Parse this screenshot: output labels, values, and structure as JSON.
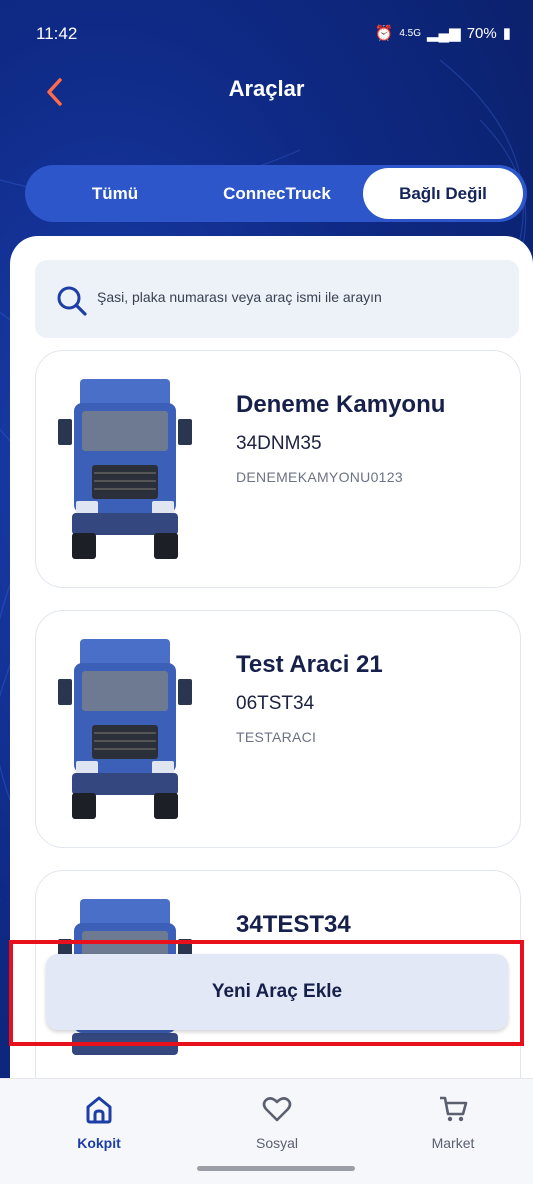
{
  "status": {
    "time": "11:42",
    "battery": "70%",
    "network": "4.5G"
  },
  "header": {
    "title": "Araçlar"
  },
  "tabs": [
    {
      "label": "Tümü",
      "active": false
    },
    {
      "label": "ConnecTruck",
      "active": false
    },
    {
      "label": "Bağlı Değil",
      "active": true
    }
  ],
  "search": {
    "placeholder": "Şasi, plaka numarası veya araç ismi ile arayın"
  },
  "vehicles": [
    {
      "name": "Deneme Kamyonu",
      "plate": "34DNM35",
      "id": "DENEMEKAMYONU0123"
    },
    {
      "name": "Test Araci 21",
      "plate": "06TST34",
      "id": "TESTARACI"
    },
    {
      "name": "34TEST34",
      "plate": "",
      "id": ""
    }
  ],
  "add_button": {
    "label": "Yeni Araç Ekle"
  },
  "bottom_nav": [
    {
      "label": "Kokpit",
      "icon": "home-icon",
      "active": true
    },
    {
      "label": "Sosyal",
      "icon": "heart-icon",
      "active": false
    },
    {
      "label": "Market",
      "icon": "cart-icon",
      "active": false
    }
  ],
  "colors": {
    "primary": "#1d3ea6",
    "background": "#0f2a86",
    "highlight": "#e8101a",
    "accent_back": "#ff6b4a"
  }
}
